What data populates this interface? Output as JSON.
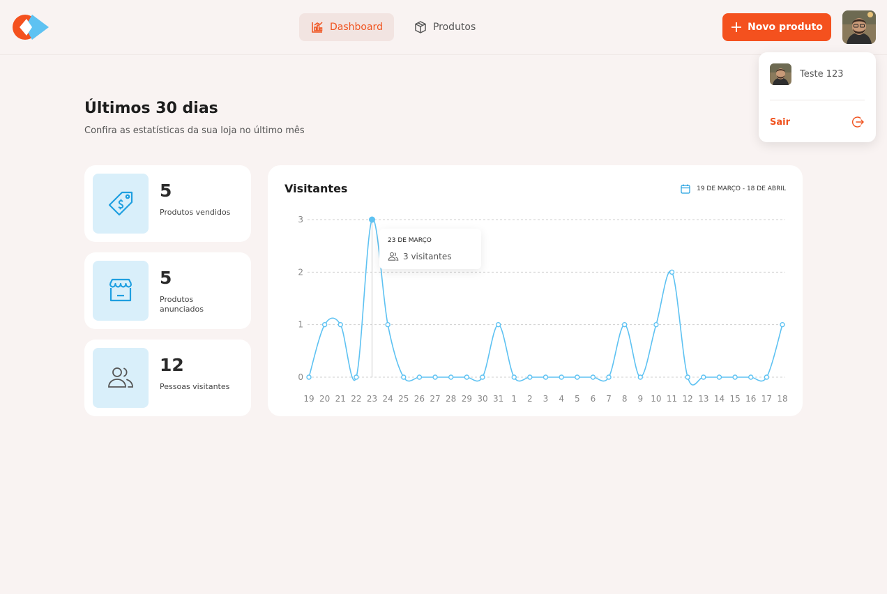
{
  "header": {
    "nav": [
      {
        "label": "Dashboard",
        "icon": "bar-chart-icon",
        "active": true
      },
      {
        "label": "Produtos",
        "icon": "box-icon",
        "active": false
      }
    ],
    "new_product_label": "Novo produto",
    "brand_colors": {
      "orange": "#f4511e",
      "blue": "#5ec2f2"
    }
  },
  "user_menu": {
    "username": "Teste 123",
    "logout_label": "Sair"
  },
  "page": {
    "title": "Últimos 30 dias",
    "subtitle": "Confira as estatísticas da sua loja no último mês"
  },
  "stats": [
    {
      "value": "5",
      "label": "Produtos vendidos",
      "icon": "price-tag-icon"
    },
    {
      "value": "5",
      "label": "Produtos anunciados",
      "icon": "store-icon"
    },
    {
      "value": "12",
      "label": "Pessoas visitantes",
      "icon": "users-icon"
    }
  ],
  "chart": {
    "title": "Visitantes",
    "date_range": "19 DE MARÇO - 18 DE ABRIL",
    "tooltip": {
      "date": "23 DE MARÇO",
      "value_text": "3 visitantes"
    }
  },
  "chart_data": {
    "type": "line",
    "categories": [
      "19",
      "20",
      "21",
      "22",
      "23",
      "24",
      "25",
      "26",
      "27",
      "28",
      "29",
      "30",
      "31",
      "1",
      "2",
      "3",
      "4",
      "5",
      "6",
      "7",
      "8",
      "9",
      "10",
      "11",
      "12",
      "13",
      "14",
      "15",
      "16",
      "17",
      "18"
    ],
    "series": [
      {
        "values": [
          0,
          1,
          1,
          0,
          3,
          1,
          0,
          0,
          0,
          0,
          0,
          0,
          1,
          0,
          0,
          0,
          0,
          0,
          0,
          0,
          1,
          0,
          1,
          2,
          0,
          0,
          0,
          0,
          0,
          0,
          1
        ]
      }
    ],
    "yticks": [
      0,
      1,
      2,
      3
    ],
    "ylim": [
      0,
      3
    ],
    "grid": true,
    "line_color": "#5ec2f2",
    "highlighted_index": 4
  }
}
